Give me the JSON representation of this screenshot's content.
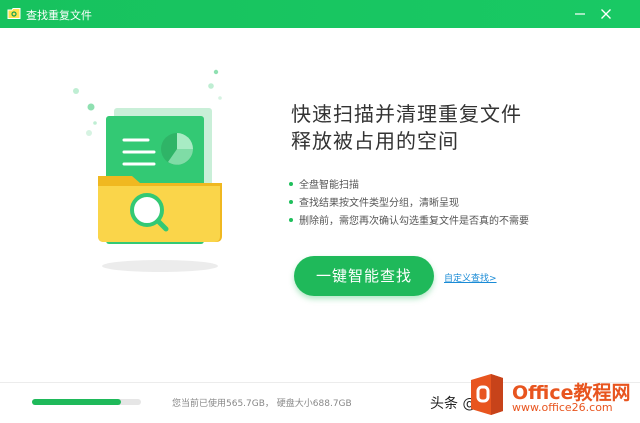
{
  "window": {
    "title": "查找重复文件"
  },
  "headline": {
    "line1": "快速扫描并清理重复文件",
    "line2": "释放被占用的空间"
  },
  "features": [
    "全盘智能扫描",
    "查找结果按文件类型分组，清晰呈现",
    "删除前，需您再次确认勾选重复文件是否真的不需要"
  ],
  "actions": {
    "scan_label": "一键智能查找",
    "custom_label": "自定义查找>"
  },
  "status": {
    "disk_used_text": "您当前已使用565.7GB，  硬盘大小688.7GB",
    "disk_used_fraction": 0.82
  },
  "watermark": {
    "toutiao": "头条 @",
    "brand": "Office教程网",
    "sub": "www.office26.com"
  },
  "colors": {
    "accent": "#1fb95a",
    "link": "#1a8bd6",
    "brand": "#e8551f"
  }
}
